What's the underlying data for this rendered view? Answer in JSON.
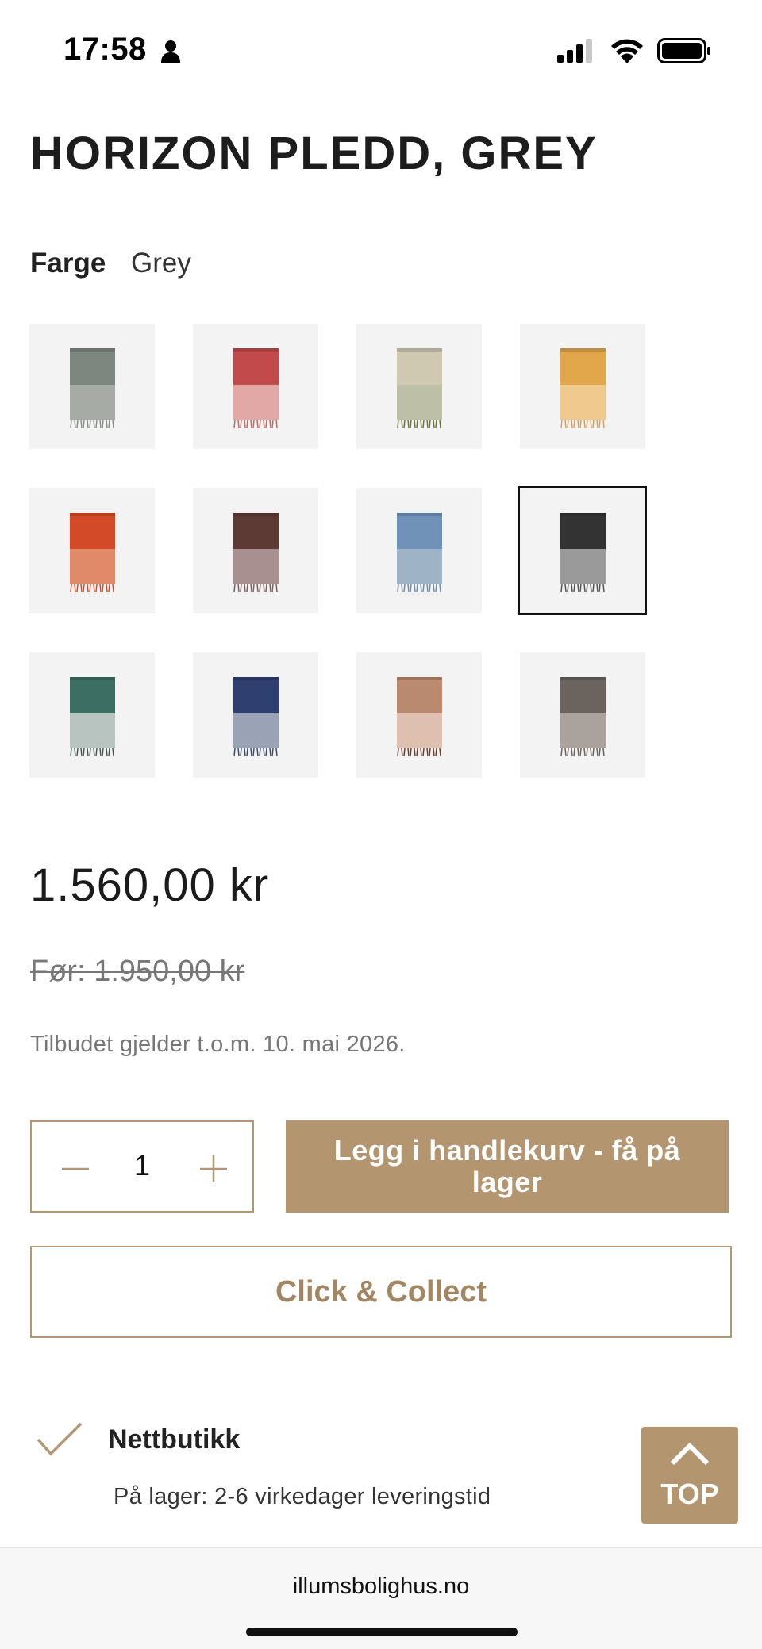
{
  "status_bar": {
    "time": "17:58"
  },
  "product": {
    "title": "HORIZON PLEDD, GREY",
    "color_label": "Farge",
    "color_value": "Grey"
  },
  "swatches": [
    {
      "name": "swatch-grey",
      "top": "#7d8780",
      "bottom": "#a6aba6",
      "fringe": "#8a8f8a"
    },
    {
      "name": "swatch-red",
      "top": "#c24a4a",
      "bottom": "#e2a8a6",
      "fringe": "#c26a66"
    },
    {
      "name": "swatch-sand",
      "top": "#cfc9b2",
      "bottom": "#bdbfa6",
      "fringe": "#6b7440"
    },
    {
      "name": "swatch-mustard",
      "top": "#e2a74a",
      "bottom": "#f0c98e",
      "fringe": "#d6a260"
    },
    {
      "name": "swatch-orange",
      "top": "#d24a28",
      "bottom": "#e08a6a",
      "fringe": "#c4533a"
    },
    {
      "name": "swatch-brown",
      "top": "#5e3a34",
      "bottom": "#a89090",
      "fringe": "#7a6060"
    },
    {
      "name": "swatch-blue",
      "top": "#7192b8",
      "bottom": "#9fb3c6",
      "fringe": "#7389a0"
    },
    {
      "name": "swatch-dark-grey",
      "top": "#333333",
      "bottom": "#9a9a9a",
      "fringe": "#555555",
      "selected": true
    },
    {
      "name": "swatch-green",
      "top": "#3d6e64",
      "bottom": "#b7c4c0",
      "fringe": "#4a5a56"
    },
    {
      "name": "swatch-navy",
      "top": "#2e3f70",
      "bottom": "#9aa2b6",
      "fringe": "#404a66"
    },
    {
      "name": "swatch-rose",
      "top": "#b98a70",
      "bottom": "#ddc0b0",
      "fringe": "#6a4030"
    },
    {
      "name": "swatch-taupe",
      "top": "#6a635e",
      "bottom": "#aaa39d",
      "fringe": "#6a635e"
    }
  ],
  "pricing": {
    "price": "1.560,00 kr",
    "old_price": "Før: 1.950,00 kr",
    "offer_note": "Tilbudet gjelder t.o.m. 10. mai 2026."
  },
  "cart": {
    "quantity": "1",
    "add_to_cart": "Legg i handlekurv - få på lager",
    "click_collect": "Click & Collect"
  },
  "availability": {
    "title": "Nettbutikk",
    "detail": "På lager: 2-6 virkedager leveringstid"
  },
  "top_button": {
    "label": "TOP"
  },
  "browser": {
    "domain": "illumsbolighus.no"
  },
  "colors": {
    "accent": "#b3966f",
    "swatch_bg": "#f3f3f3"
  }
}
